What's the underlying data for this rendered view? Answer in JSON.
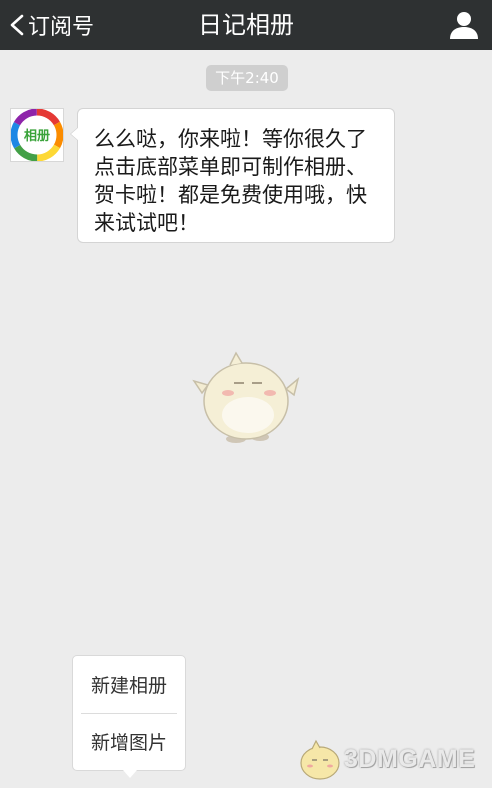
{
  "header": {
    "back_label": "订阅号",
    "title": "日记相册"
  },
  "chat": {
    "timestamp": "下午2:40",
    "avatar_text": "相册",
    "message": "么么哒，你来啦！等你很久了 点击底部菜单即可制作相册、贺卡啦！都是免费使用哦，快来试试吧！"
  },
  "popup_menu": {
    "items": [
      {
        "label": "新建相册"
      },
      {
        "label": "新增图片"
      }
    ]
  },
  "watermark": {
    "text": "3DMGAME"
  },
  "colors": {
    "header_bg": "#2e3132",
    "chat_bg": "#ececec",
    "timestamp_bg": "#cfcfcf"
  }
}
